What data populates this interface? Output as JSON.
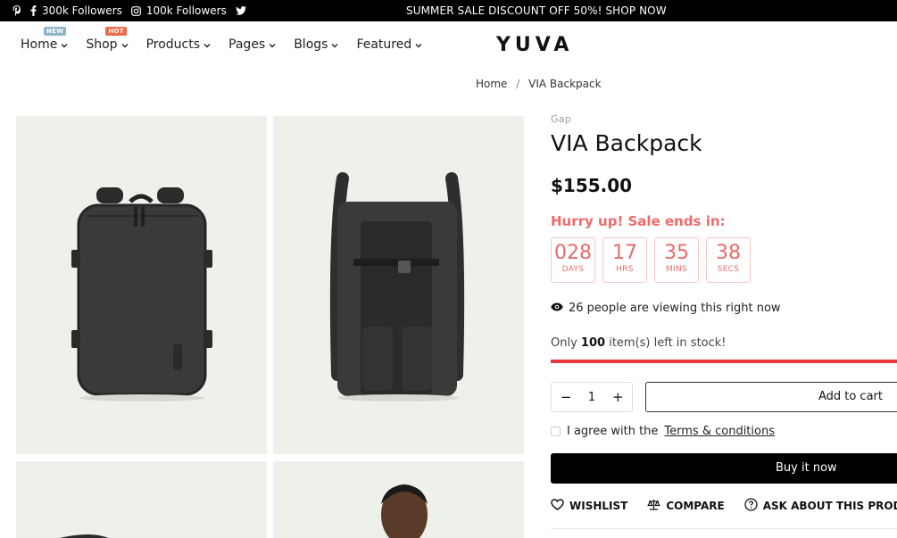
{
  "topbar": {
    "facebook_followers": "300k Followers",
    "instagram_followers": "100k Followers",
    "promo": "SUMMER SALE DISCOUNT OFF 50%! SHOP NOW"
  },
  "nav": {
    "items": [
      {
        "label": "Home",
        "badge": "NEW"
      },
      {
        "label": "Shop",
        "badge": "HOT"
      },
      {
        "label": "Products"
      },
      {
        "label": "Pages"
      },
      {
        "label": "Blogs"
      },
      {
        "label": "Featured"
      }
    ],
    "logo": "YUVA"
  },
  "breadcrumb": {
    "home": "Home",
    "sep": "/",
    "current": "VIA Backpack"
  },
  "product": {
    "brand": "Gap",
    "title": "VIA Backpack",
    "price": "$155.00",
    "hurry": "Hurry up! Sale ends in:",
    "countdown": [
      {
        "value": "028",
        "unit": "DAYS"
      },
      {
        "value": "17",
        "unit": "HRS"
      },
      {
        "value": "35",
        "unit": "MINS"
      },
      {
        "value": "38",
        "unit": "SECS"
      }
    ],
    "viewing": "26 people are viewing this right now",
    "stock_prefix": "Only",
    "stock_count": "100",
    "stock_suffix": "item(s) left in stock!",
    "stock_fill_fraction": 1.0,
    "quantity": "1",
    "add_to_cart": "Add to cart",
    "agree_text": "I agree with the",
    "terms_link": "Terms & conditions",
    "buy_now": "Buy it now",
    "actions": {
      "wishlist": "WISHLIST",
      "compare": "COMPARE",
      "ask": "ASK ABOUT THIS PRODUCT"
    }
  },
  "colors": {
    "accent_red": "#e8383d",
    "countdown_red": "#e86b6b",
    "image_bg": "#edf1e9"
  }
}
